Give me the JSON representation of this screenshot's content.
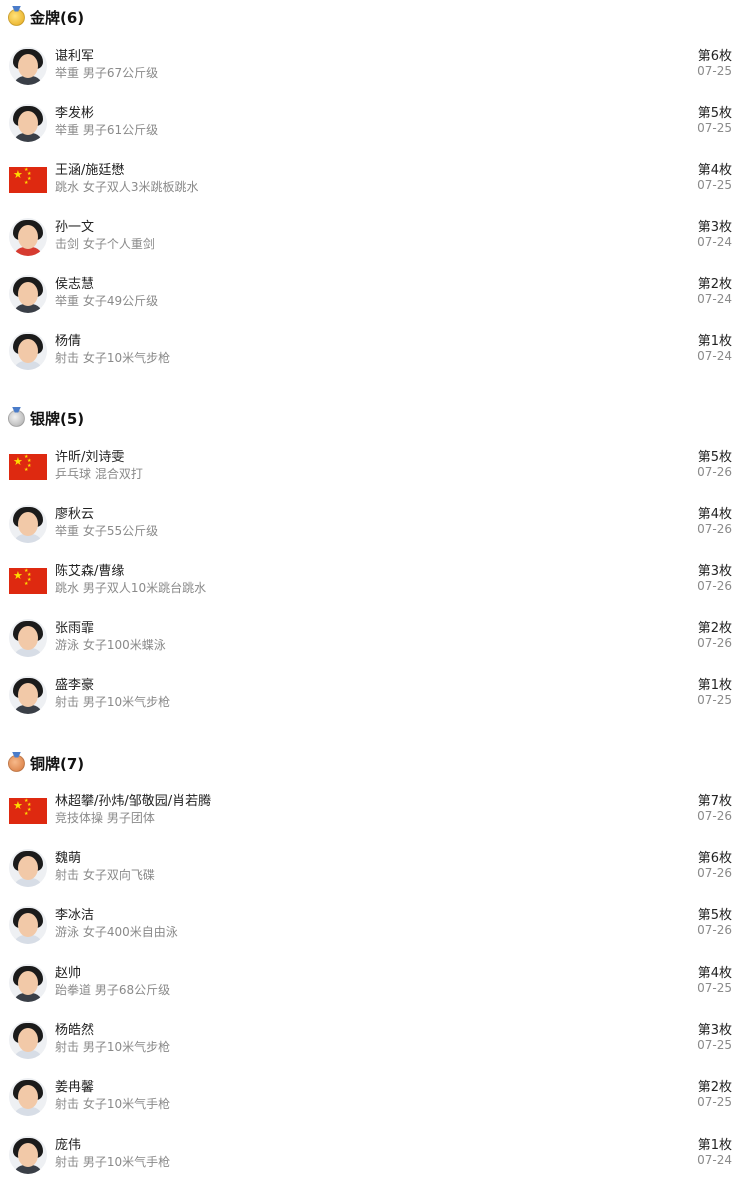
{
  "colors": {
    "flag_red": "#de2910",
    "flag_star": "#ffde00",
    "muted_text": "#8a8a8a"
  },
  "gold": {
    "title": "金牌(6)",
    "icon": "gold-medal-icon",
    "items": [
      {
        "name": "谌利军",
        "event": "举重 男子67公斤级",
        "count": "第6枚",
        "date": "07-25",
        "thumb": "avatar"
      },
      {
        "name": "李发彬",
        "event": "举重 男子61公斤级",
        "count": "第5枚",
        "date": "07-25",
        "thumb": "avatar"
      },
      {
        "name": "王涵/施廷懋",
        "event": "跳水 女子双人3米跳板跳水",
        "count": "第4枚",
        "date": "07-25",
        "thumb": "flag"
      },
      {
        "name": "孙一文",
        "event": "击剑 女子个人重剑",
        "count": "第3枚",
        "date": "07-24",
        "thumb": "avatar"
      },
      {
        "name": "侯志慧",
        "event": "举重 女子49公斤级",
        "count": "第2枚",
        "date": "07-24",
        "thumb": "avatar"
      },
      {
        "name": "杨倩",
        "event": "射击 女子10米气步枪",
        "count": "第1枚",
        "date": "07-24",
        "thumb": "avatar"
      }
    ]
  },
  "silver": {
    "title": "银牌(5)",
    "icon": "silver-medal-icon",
    "items": [
      {
        "name": "许昕/刘诗雯",
        "event": "乒乓球 混合双打",
        "count": "第5枚",
        "date": "07-26",
        "thumb": "flag"
      },
      {
        "name": "廖秋云",
        "event": "举重 女子55公斤级",
        "count": "第4枚",
        "date": "07-26",
        "thumb": "avatar"
      },
      {
        "name": "陈艾森/曹缘",
        "event": "跳水 男子双人10米跳台跳水",
        "count": "第3枚",
        "date": "07-26",
        "thumb": "flag"
      },
      {
        "name": "张雨霏",
        "event": "游泳 女子100米蝶泳",
        "count": "第2枚",
        "date": "07-26",
        "thumb": "avatar"
      },
      {
        "name": "盛李豪",
        "event": "射击 男子10米气步枪",
        "count": "第1枚",
        "date": "07-25",
        "thumb": "avatar"
      }
    ]
  },
  "bronze": {
    "title": "铜牌(7)",
    "icon": "bronze-medal-icon",
    "items": [
      {
        "name": "林超攀/孙炜/邹敬园/肖若腾",
        "event": "竞技体操 男子团体",
        "count": "第7枚",
        "date": "07-26",
        "thumb": "flag"
      },
      {
        "name": "魏萌",
        "event": "射击 女子双向飞碟",
        "count": "第6枚",
        "date": "07-26",
        "thumb": "avatar"
      },
      {
        "name": "李冰洁",
        "event": "游泳 女子400米自由泳",
        "count": "第5枚",
        "date": "07-26",
        "thumb": "avatar"
      },
      {
        "name": "赵帅",
        "event": "跆拳道 男子68公斤级",
        "count": "第4枚",
        "date": "07-25",
        "thumb": "avatar"
      },
      {
        "name": "杨皓然",
        "event": "射击 男子10米气步枪",
        "count": "第3枚",
        "date": "07-25",
        "thumb": "avatar"
      },
      {
        "name": "姜冉馨",
        "event": "射击 女子10米气手枪",
        "count": "第2枚",
        "date": "07-25",
        "thumb": "avatar"
      },
      {
        "name": "庞伟",
        "event": "射击 男子10米气手枪",
        "count": "第1枚",
        "date": "07-24",
        "thumb": "avatar"
      }
    ]
  }
}
